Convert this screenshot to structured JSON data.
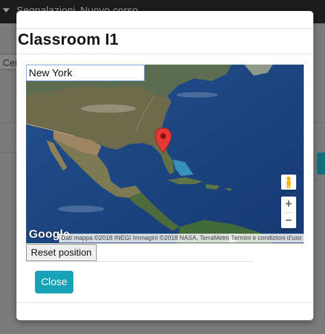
{
  "background": {
    "navbar": {
      "items": [
        "Segnalazioni",
        "Nuovo corso"
      ]
    },
    "left_tab_label": "Cer"
  },
  "modal": {
    "title": "Classroom I1",
    "map": {
      "search_value": "New York",
      "logo_text": "Google",
      "attribution": "Dati mappa ©2018 INEGI Immagini ©2018 NASA, TerraMetrics",
      "terms": "Termini e condizioni d'uso",
      "zoom_in_label": "+",
      "zoom_out_label": "−",
      "marker_color": "#e53935"
    },
    "reset_button_label": "Reset position",
    "close_button_label": "Close"
  },
  "colors": {
    "accent": "#17a2b8",
    "navbar": "#1c1c1c"
  }
}
